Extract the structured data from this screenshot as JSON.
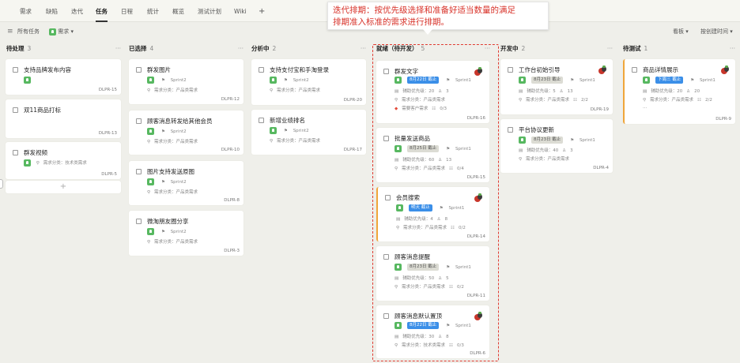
{
  "tabs": [
    {
      "label": "需求"
    },
    {
      "label": "缺陷"
    },
    {
      "label": "迭代"
    },
    {
      "label": "任务"
    },
    {
      "label": "日程"
    },
    {
      "label": "统计"
    },
    {
      "label": "概览"
    },
    {
      "label": "测试计划"
    },
    {
      "label": "Wiki"
    },
    {
      "label": "+"
    }
  ],
  "active_tab": "任务",
  "filter": {
    "all_tasks": "所有任务",
    "type": "需求",
    "view": "看板",
    "sort": "按创建时间"
  },
  "annotation": {
    "line1": "迭代排期：按优先级选择和准备好适当数量的满足",
    "line2": "排期准入标准的需求进行排期。"
  },
  "columns": [
    {
      "name": "待处理",
      "count": "3"
    },
    {
      "name": "已选择",
      "count": "4"
    },
    {
      "name": "分析中",
      "count": "2"
    },
    {
      "name": "就绪（待开发）",
      "count": "5"
    },
    {
      "name": "开发中",
      "count": "2"
    },
    {
      "name": "待测试",
      "count": "1"
    }
  ],
  "cards": {
    "c0_0": {
      "title": "支持品牌发布内容",
      "id": "DLPR-15"
    },
    "c0_1": {
      "title": "双11商品打标",
      "id": "DLPR-13"
    },
    "c0_2": {
      "title": "群发视频",
      "cat": "需求分类：技术类需求",
      "id": "DLPR-5"
    },
    "c1_0": {
      "title": "群发图片",
      "sprint": "Sprint2",
      "cat": "需求分类：产品类需求",
      "id": "DLPR-12"
    },
    "c1_1": {
      "title": "顾客消息转发给其他会员",
      "sprint": "Sprint2",
      "cat": "需求分类：产品类需求",
      "id": "DLPR-10"
    },
    "c1_2": {
      "title": "图片支持发送原图",
      "sprint": "Sprint2",
      "cat": "需求分类：产品类需求",
      "id": "DLPR-8"
    },
    "c1_3": {
      "title": "微淘朋友圈分享",
      "sprint": "Sprint2",
      "cat": "需求分类：产品类需求",
      "id": "DLPR-3"
    },
    "c2_0": {
      "title": "支持支付宝和手淘登录",
      "sprint": "Sprint2",
      "cat": "需求分类：产品类需求",
      "id": "DLPR-20"
    },
    "c2_1": {
      "title": "新增业绩排名",
      "sprint": "Sprint2",
      "cat": "需求分类：产品类需求",
      "id": "DLPR-17"
    },
    "c3_0": {
      "title": "群发文字",
      "date": "8月22日 截止",
      "sprint": "Sprint1",
      "prio": "辅助优先级：20",
      "people": "3",
      "cat": "需求分类：产品类需求",
      "extra": "需要客户需求",
      "sub": "0/3",
      "id": "DLPR-16"
    },
    "c3_1": {
      "title": "批量发送商品",
      "date": "8月25日 截止",
      "sprint": "Sprint1",
      "prio": "辅助优先级：60",
      "people": "13",
      "cat": "需求分类：产品类需求",
      "sub": "0/4",
      "id": "DLPR-15"
    },
    "c3_2": {
      "title": "会员搜索",
      "date": "明天 截止",
      "sprint": "Sprint1",
      "prio": "辅助优先级：4",
      "people": "8",
      "cat": "需求分类：产品类需求",
      "sub": "0/2",
      "id": "DLPR-14"
    },
    "c3_3": {
      "title": "顾客消息提醒",
      "date": "8月23日 截止",
      "sprint": "Sprint1",
      "prio": "辅助优先级：50",
      "people": "5",
      "cat": "需求分类：产品类需求",
      "sub": "0/2",
      "id": "DLPR-11"
    },
    "c3_4": {
      "title": "顾客消息默认置顶",
      "date": "8月22日 截止",
      "sprint": "Sprint1",
      "prio": "辅助优先级：30",
      "people": "8",
      "cat": "需求分类：技术类需求",
      "sub": "0/3",
      "id": "DLPR-6"
    },
    "c4_0": {
      "title": "工作台初始引导",
      "date": "8月23日 截止",
      "sprint": "Sprint1",
      "prio": "辅助优先级：5",
      "people": "13",
      "cat": "需求分类：产品类需求",
      "sub": "2/2",
      "id": "DLPR-19"
    },
    "c4_1": {
      "title": "平台协议更新",
      "date": "8月23日 截止",
      "sprint": "Sprint1",
      "prio": "辅助优先级：40",
      "people": "3",
      "cat": "需求分类：产品类需求",
      "id": "DLPR-4"
    },
    "c5_0": {
      "title": "商品详情展示",
      "date": "下周三 截止",
      "sprint": "Sprint1",
      "prio": "辅助优先级：20",
      "people": "20",
      "cat": "需求分类：产品类需求",
      "sub": "2/2",
      "more": "...",
      "id": "DLPR-9"
    }
  },
  "colors": {
    "accent": "#3b8fe8",
    "bulb": "#57b860",
    "highlight": "#e03a30",
    "warning_bar": "#f0a63a"
  }
}
